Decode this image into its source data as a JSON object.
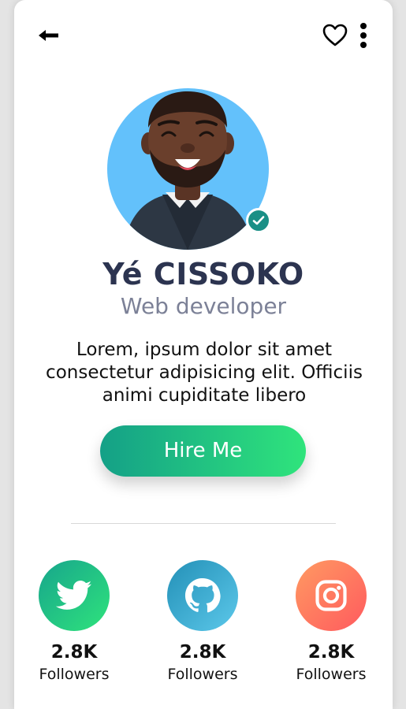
{
  "header": {
    "back_icon": "arrow-left-icon",
    "favorite_icon": "heart-icon",
    "more_icon": "vertical-dots-icon"
  },
  "profile": {
    "name": "Yé CISSOKO",
    "role": "Web developer",
    "bio": "Lorem, ipsum dolor sit amet consectetur adipisicing elit. Officiis animi cupiditate libero",
    "verified_icon": "check-badge-icon",
    "avatar_bg": "#63c1fb"
  },
  "hire_button": {
    "label": "Hire Me",
    "gradient": [
      "#14a087",
      "#2fe47c"
    ]
  },
  "socials": [
    {
      "network": "twitter",
      "icon": "twitter-icon",
      "count": "2.8K",
      "label": "Followers",
      "color": "#1fbf85"
    },
    {
      "network": "github",
      "icon": "github-icon",
      "count": "2.8K",
      "label": "Followers",
      "color": "#3aa9d2"
    },
    {
      "network": "instagram",
      "icon": "instagram-icon",
      "count": "2.8K",
      "label": "Followers",
      "color": "#ff7a60"
    }
  ]
}
